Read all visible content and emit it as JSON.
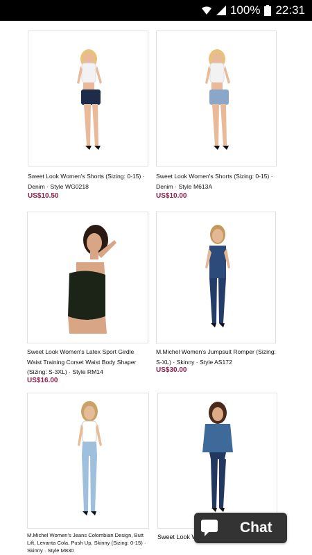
{
  "status_bar": {
    "battery": "100%",
    "time": "22:31"
  },
  "products": [
    {
      "title": "Sweet Look Women's Shorts (Sizing: 0-15) · Denim · Style WG0218",
      "price": "US$10.50"
    },
    {
      "title": "Sweet Look Women's Shorts (Sizing: 0-15) · Denim · Style M613A",
      "price": "US$10.00"
    },
    {
      "title": "Sweet Look Women's Latex Sport Girdle Waist Training Corset Waist Body Shaper (Sizing: S-3XL) · Style RM14",
      "price": "US$16.00"
    },
    {
      "title": "M.Michel Women's Jumpsuit Romper (Sizing: S-XL) · Skinny · Style AS172",
      "price": "US$30.00"
    },
    {
      "title": "M.Michel Women's Jeans Colombian Design, Butt Lift, Levanta Cola, Push Up, Skinny (Sizing: 0-15) · Skinny · Style M830",
      "price": ""
    },
    {
      "title": "Sweet Look Women's Jeans · Style N559A",
      "price": ""
    }
  ],
  "chat": {
    "label": "Chat"
  },
  "colors": {
    "price": "#8b1e4a",
    "status_bar": "#000000",
    "chat_bg": "#333333"
  }
}
